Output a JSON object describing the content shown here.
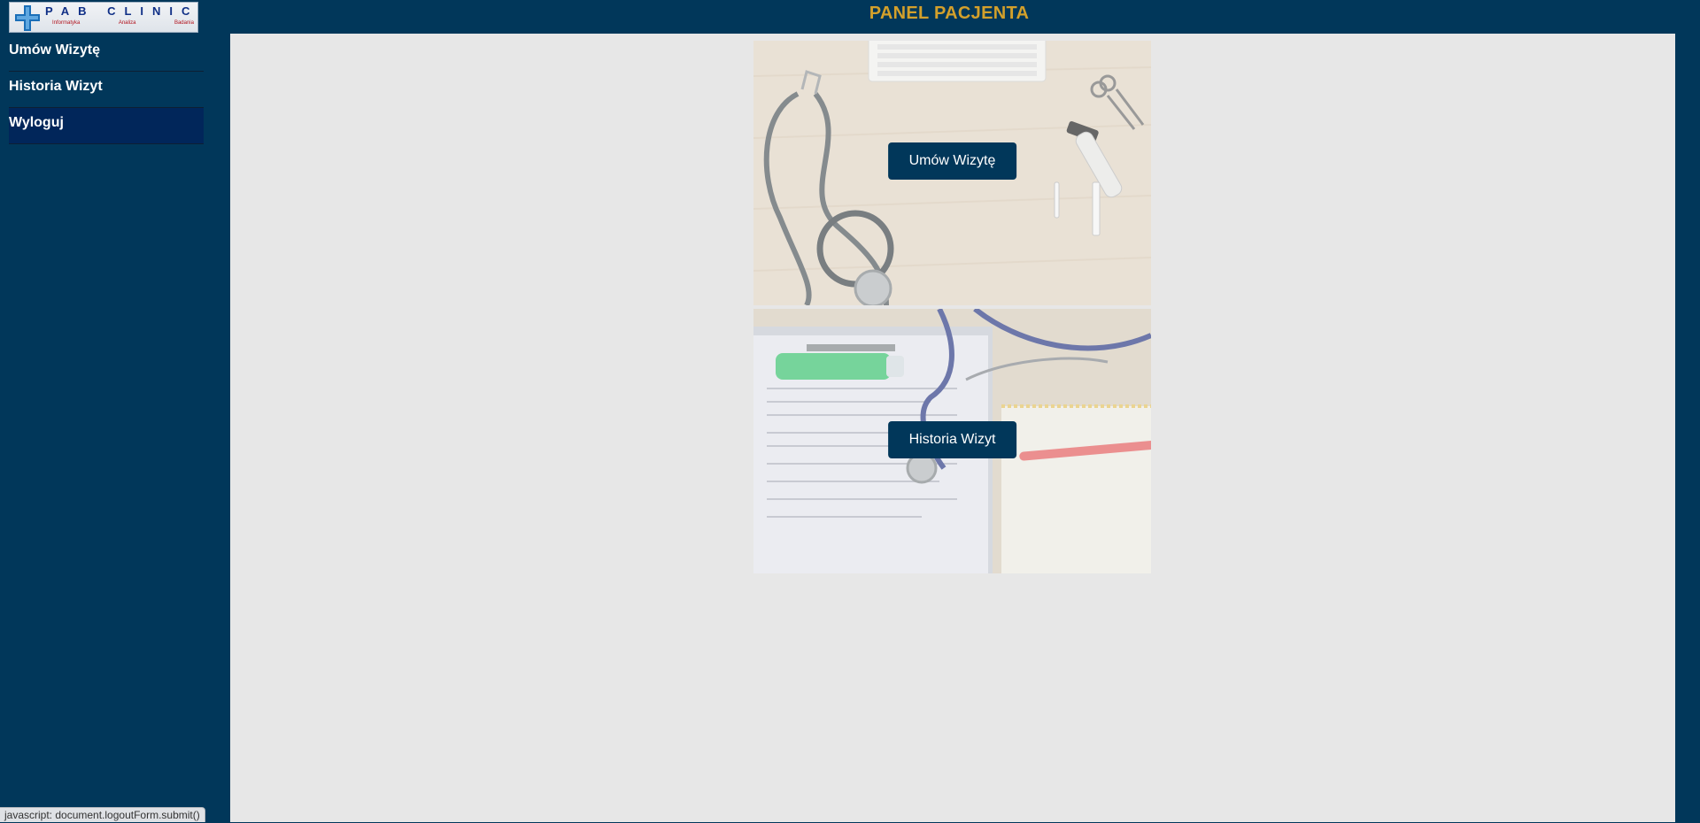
{
  "logo": {
    "name": "PAB CLINIC",
    "sub": [
      "Informatyka",
      "Analiza",
      "Badania"
    ]
  },
  "header": {
    "title": "PANEL PACJENTA"
  },
  "sidebar": {
    "items": [
      {
        "label": "Umów Wizytę",
        "active": false
      },
      {
        "label": "Historia Wizyt",
        "active": false
      },
      {
        "label": "Wyloguj",
        "active": true
      }
    ]
  },
  "cards": [
    {
      "button_label": "Umów Wizytę",
      "image": "stethoscope-desk-image"
    },
    {
      "button_label": "Historia Wizyt",
      "image": "medical-documents-image"
    }
  ],
  "status_bar": {
    "text": "javascript: document.logoutForm.submit()"
  },
  "colors": {
    "background": "#01375a",
    "title": "#d3a02b",
    "content": "#e7e7e7",
    "button": "#01375a"
  }
}
